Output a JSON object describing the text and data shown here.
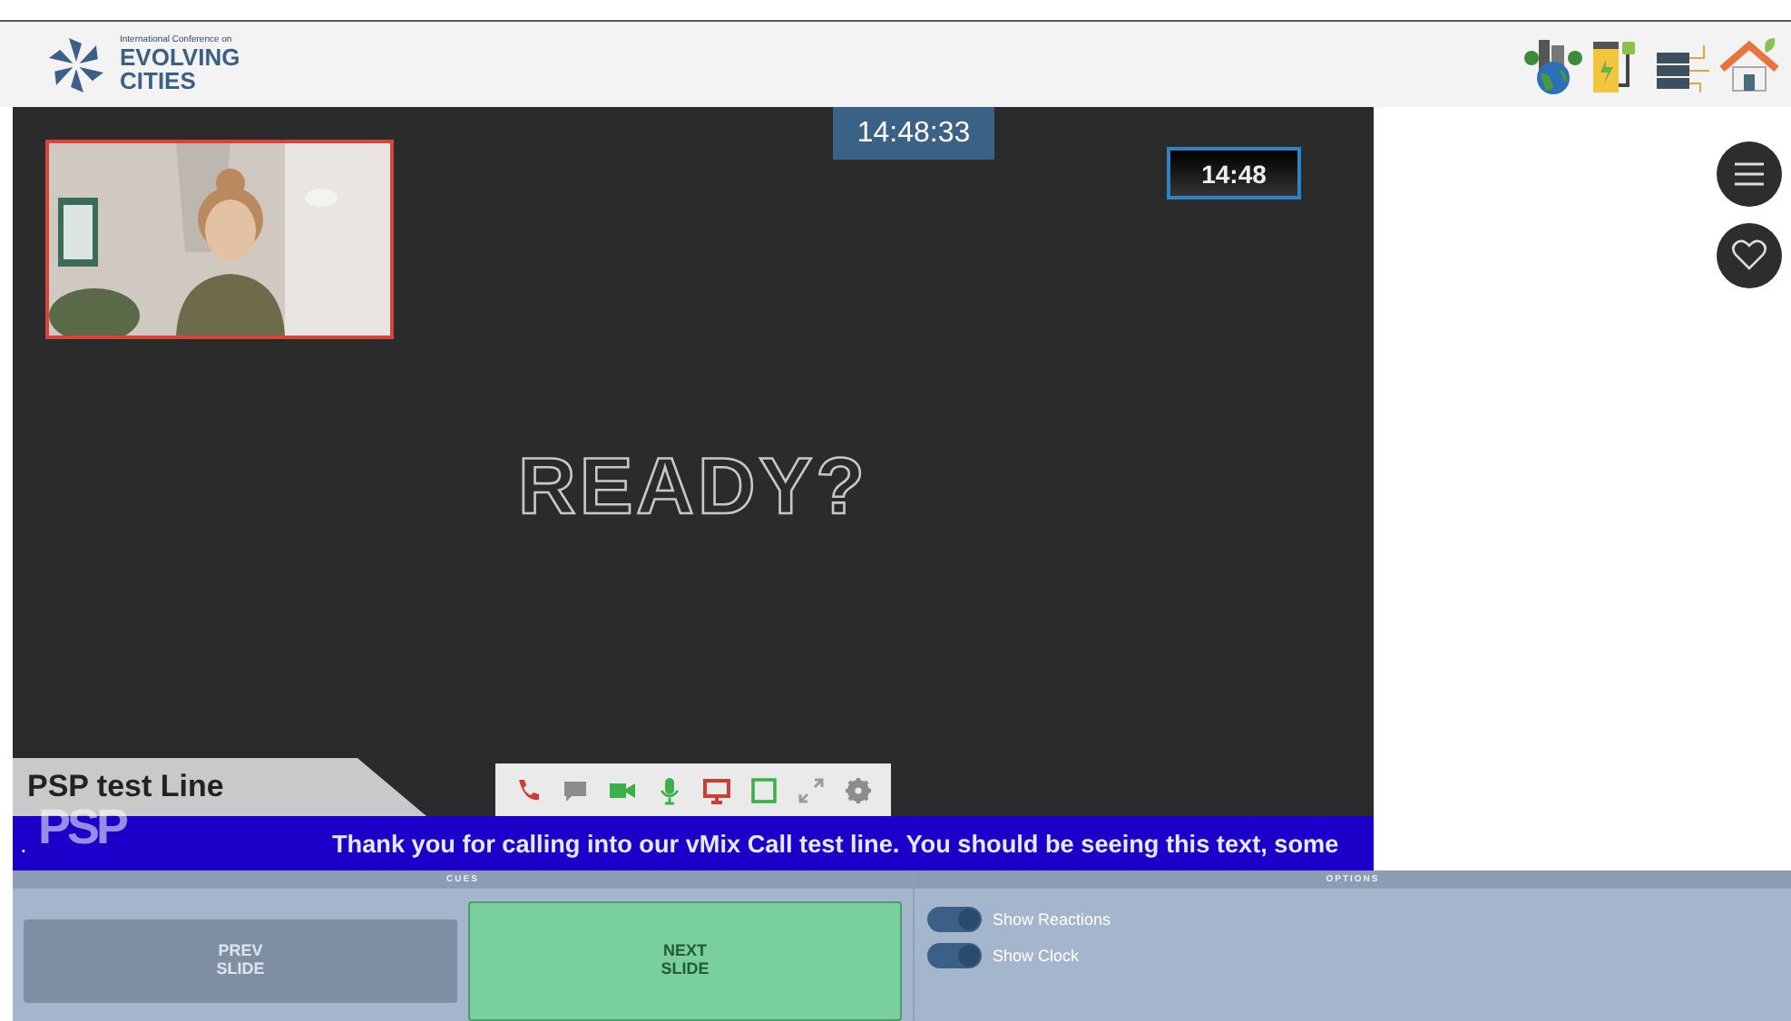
{
  "header": {
    "logo": {
      "tagline": "International Conference on",
      "line1": "EVOLVING",
      "line2": "CITIES"
    }
  },
  "stage": {
    "clock": "14:48:33",
    "small_clock": "14:48",
    "title": "READY?",
    "lower_third": "PSP test Line",
    "ticker": {
      "lead": ".",
      "logo": "PSP",
      "text": "Thank you for calling into our vMix Call test line. You should be seeing this text, some"
    },
    "toolbar": [
      {
        "kind": "phone",
        "color": "#d23b32"
      },
      {
        "kind": "chat",
        "color": "#8c8c8c"
      },
      {
        "kind": "camera",
        "color": "#3cae4a"
      },
      {
        "kind": "mic",
        "color": "#3cae4a"
      },
      {
        "kind": "screen",
        "color": "#d23b32"
      },
      {
        "kind": "frame",
        "color": "#3cae4a"
      },
      {
        "kind": "expand",
        "color": "#9a9a9a"
      },
      {
        "kind": "gear",
        "color": "#8c8c8c"
      }
    ]
  },
  "side_buttons": [
    {
      "kind": "menu"
    },
    {
      "kind": "heart"
    }
  ],
  "cues": {
    "heading": "CUES",
    "buttons": [
      {
        "label": "PREV\nSLIDE",
        "selected": false
      },
      {
        "label": "NEXT\nSLIDE",
        "selected": true
      }
    ]
  },
  "options": {
    "heading": "OPTIONS",
    "toggles": [
      {
        "label": "Show Reactions",
        "on": true
      },
      {
        "label": "Show Clock",
        "on": true
      }
    ]
  }
}
